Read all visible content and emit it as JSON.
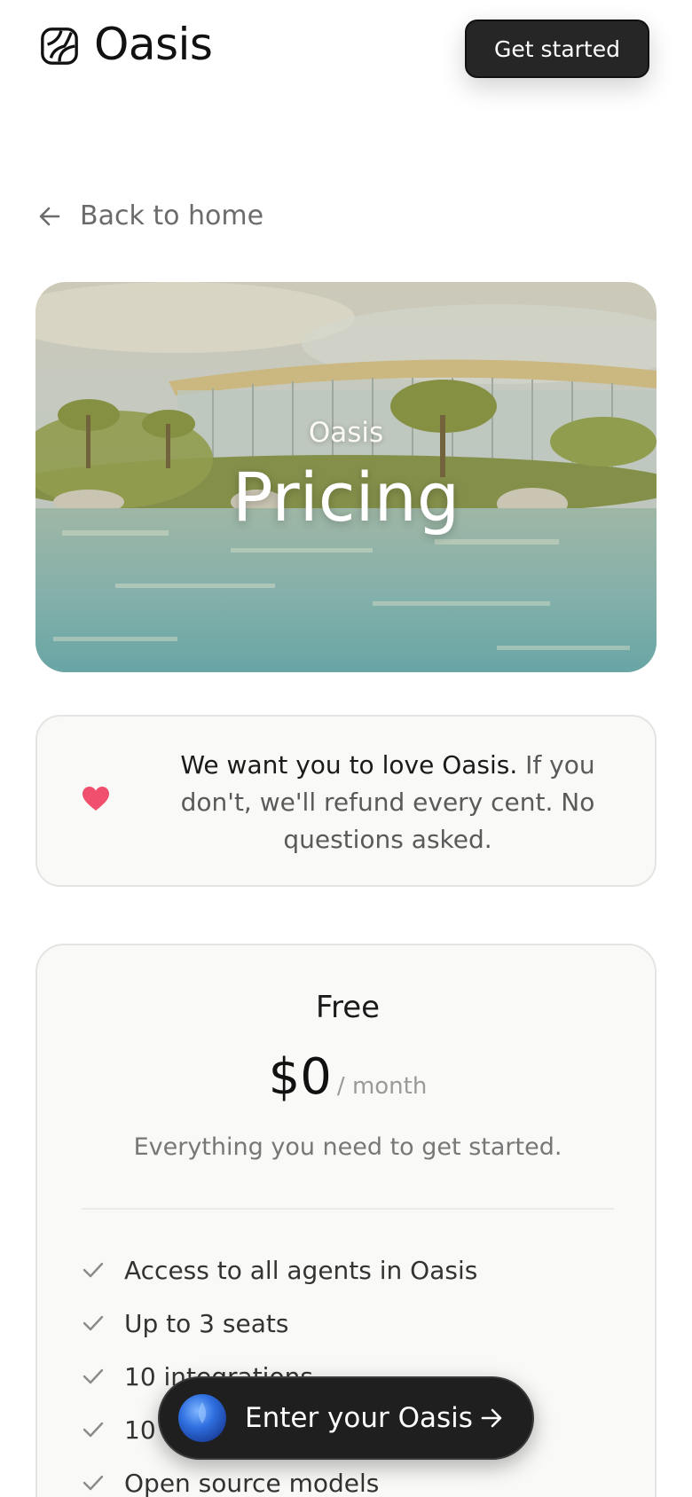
{
  "header": {
    "brand_name": "Oasis",
    "cta_label": "Get started"
  },
  "nav": {
    "back_label": "Back to home"
  },
  "hero": {
    "eyebrow": "Oasis",
    "title": "Pricing"
  },
  "guarantee": {
    "strong_text": "We want you to love Oasis.",
    "rest_text": " If you don't, we'll refund every cent. No questions asked."
  },
  "plan": {
    "name": "Free",
    "price": "$0",
    "period": "/ month",
    "description": "Everything you need to get started.",
    "features": [
      "Access to all agents in Oasis",
      "Up to 3 seats",
      "10 integrations",
      "10",
      "Open source models"
    ]
  },
  "floating_cta": {
    "label": "Enter your Oasis"
  },
  "colors": {
    "accent_dark": "#262626",
    "heart": "#f0506e",
    "orb": "#2f6fe0"
  }
}
